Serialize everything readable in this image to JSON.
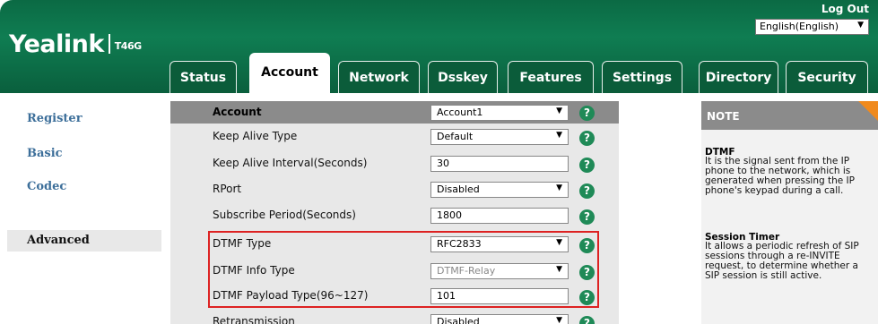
{
  "header": {
    "logo": "Yealink",
    "model": "T46G",
    "logout": "Log Out",
    "language": "English(English)"
  },
  "tabs": [
    {
      "label": "Status",
      "active": false
    },
    {
      "label": "Account",
      "active": true
    },
    {
      "label": "Network",
      "active": false
    },
    {
      "label": "Dsskey",
      "active": false
    },
    {
      "label": "Features",
      "active": false
    },
    {
      "label": "Settings",
      "active": false
    },
    {
      "label": "Directory",
      "active": false
    },
    {
      "label": "Security",
      "active": false
    }
  ],
  "sidebar": {
    "items": [
      {
        "label": "Register",
        "active": false
      },
      {
        "label": "Basic",
        "active": false
      },
      {
        "label": "Codec",
        "active": false
      },
      {
        "label": "Advanced",
        "active": true
      }
    ]
  },
  "form": {
    "header": {
      "label": "Account",
      "value": "Account1"
    },
    "rows": [
      {
        "label": "Keep Alive Type",
        "value": "Default",
        "type": "select"
      },
      {
        "label": "Keep Alive Interval(Seconds)",
        "value": "30",
        "type": "input"
      },
      {
        "label": "RPort",
        "value": "Disabled",
        "type": "select"
      },
      {
        "label": "Subscribe Period(Seconds)",
        "value": "1800",
        "type": "input"
      },
      {
        "label": "DTMF Type",
        "value": "RFC2833",
        "type": "select"
      },
      {
        "label": "DTMF Info Type",
        "value": "DTMF-Relay",
        "type": "select",
        "disabled": true
      },
      {
        "label": "DTMF Payload Type(96~127)",
        "value": "101",
        "type": "input"
      },
      {
        "label": "Retransmission",
        "value": "Disabled",
        "type": "select"
      }
    ],
    "help_symbol": "?"
  },
  "note": {
    "header": "NOTE",
    "sections": [
      {
        "title": "DTMF",
        "text": "It is the signal sent from the IP phone to the network, which is generated when pressing the IP phone's keypad during a call."
      },
      {
        "title": "Session Timer",
        "text": "It allows a periodic refresh of SIP sessions through a re-INVITE request, to determine whether a SIP session is still active."
      }
    ]
  },
  "colors": {
    "header_green": "#0f7d52",
    "tab_green": "#0b5c3a",
    "nav_blue": "#3d6f9a",
    "help_green": "#1f8a57",
    "highlight_red": "#dd2222",
    "note_corner": "#f08a1d"
  },
  "icons": {
    "dropdown": "chevron-down-icon",
    "help": "help-icon"
  }
}
